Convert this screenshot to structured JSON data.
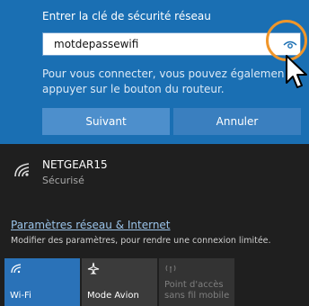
{
  "dialog": {
    "prompt": "Entrer la clé de sécurité réseau",
    "password_value": "motdepassewifi",
    "info_line1": "Pour vous connecter, vous pouvez égalemen",
    "info_line2": "appuyer sur le bouton du routeur.",
    "next_label": "Suivant",
    "cancel_label": "Annuler"
  },
  "network": {
    "name": "NETGEAR15",
    "status": "Sécurisé"
  },
  "settings": {
    "link_text": "Paramètres réseau & Internet",
    "description": "Modifier des paramètres, pour rendre une connexion limitée."
  },
  "tiles": {
    "wifi_label": "Wi-Fi",
    "airplane_label": "Mode Avion",
    "hotspot_line1": "Point d'accès",
    "hotspot_line2": "sans fil mobile"
  },
  "colors": {
    "accent": "#1a6fb3",
    "highlight": "#f0962a",
    "background": "#1f1f1f"
  },
  "icons": {
    "reveal": "eye-icon",
    "wifi": "wifi-icon",
    "airplane": "airplane-icon",
    "hotspot": "hotspot-icon"
  }
}
